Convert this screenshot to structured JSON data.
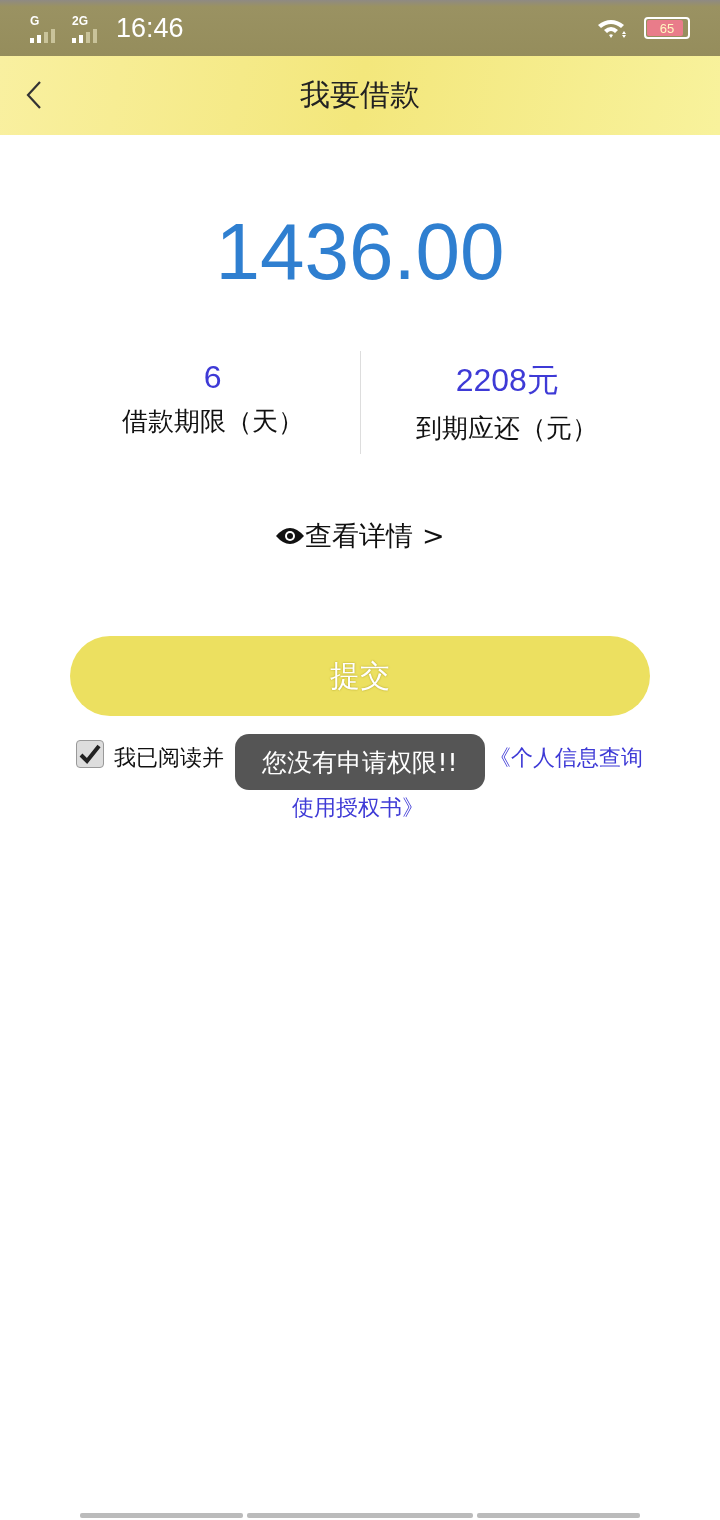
{
  "status_bar": {
    "signal_1_label": "G",
    "signal_2_label": "2G",
    "time": "16:46",
    "battery": "65"
  },
  "header": {
    "title": "我要借款"
  },
  "amount": "1436.00",
  "stats": [
    {
      "value": "6",
      "label": "借款期限（天）"
    },
    {
      "value": "2208元",
      "label": "到期应还（元）"
    }
  ],
  "details_link": "查看详情 >",
  "submit_button": {
    "label": "提交",
    "disabled": true
  },
  "agreement": {
    "checked": true,
    "prefix": "我已阅读并",
    "link_lines": [
      "《个人信息查询",
      "使用授权书》"
    ]
  },
  "toast": "您没有申请权限!!"
}
